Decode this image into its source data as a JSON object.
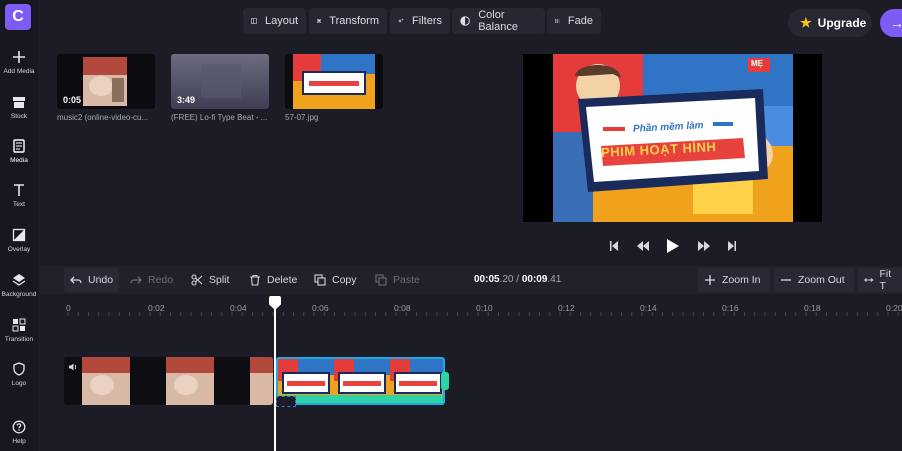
{
  "app": {
    "logo_letter": "C"
  },
  "sidebar": {
    "items": [
      {
        "label": "Add Media",
        "icon": "plus-icon"
      },
      {
        "label": "Stock",
        "icon": "stock-icon"
      },
      {
        "label": "Media",
        "icon": "media-icon"
      },
      {
        "label": "Text",
        "icon": "text-icon"
      },
      {
        "label": "Overlay",
        "icon": "overlay-icon"
      },
      {
        "label": "Background",
        "icon": "background-icon"
      },
      {
        "label": "Transition",
        "icon": "transition-icon"
      },
      {
        "label": "Logo",
        "icon": "shield-icon"
      },
      {
        "label": "Help",
        "icon": "help-icon"
      }
    ]
  },
  "top_toolbar": {
    "layout": "Layout",
    "transform": "Transform",
    "filters": "Filters",
    "color_balance": "Color Balance",
    "fade": "Fade",
    "upgrade": "Upgrade",
    "export_arrow": "→"
  },
  "media": [
    {
      "name": "music2 (online-video-cu...",
      "duration": "0:05"
    },
    {
      "name": "(FREE) Lo-fi Type Beat - ...",
      "duration": "3:49"
    },
    {
      "name": "57-07.jpg",
      "duration": ""
    }
  ],
  "preview": {
    "line1": "Phần mềm làm",
    "line2": "PHIM HOẠT HÌNH",
    "badge": "MẸ"
  },
  "edit_toolbar": {
    "undo": "Undo",
    "redo": "Redo",
    "split": "Split",
    "delete": "Delete",
    "copy": "Copy",
    "paste": "Paste",
    "zoom_in": "Zoom In",
    "zoom_out": "Zoom Out",
    "fit": "Fit T"
  },
  "timecode": {
    "current_main": "00:05",
    "current_frac": ".20",
    "separator": " / ",
    "total_main": "00:09",
    "total_frac": ".41"
  },
  "ruler": {
    "ticks": [
      "0",
      "0:02",
      "0:04",
      "0:06",
      "0:08",
      "0:10",
      "0:12",
      "0:14",
      "0:16",
      "0:18",
      "0:20"
    ]
  },
  "colors": {
    "accent": "#7d5cf5",
    "clip_border": "#1fa9e0",
    "handle": "#2ed3a7"
  }
}
